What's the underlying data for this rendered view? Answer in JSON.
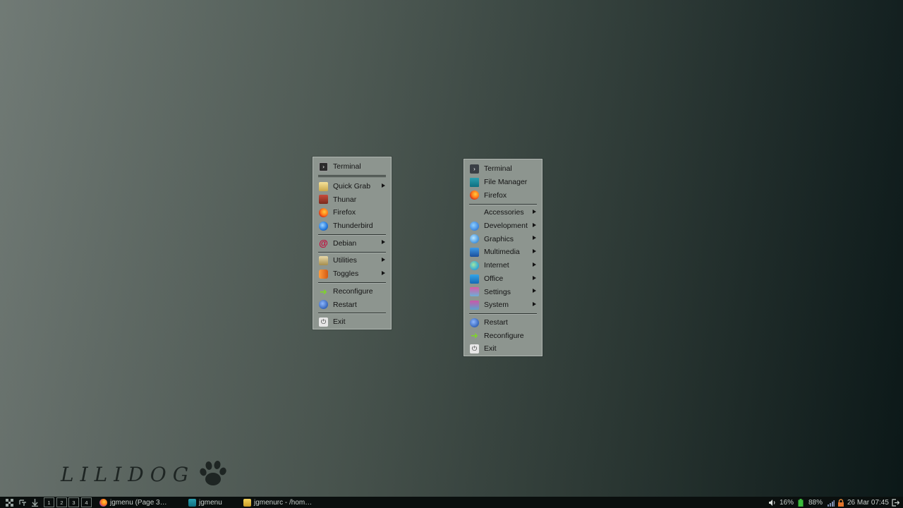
{
  "menu_left": {
    "items": [
      {
        "label": "Terminal",
        "icon": "terminal-icon",
        "submenu": false
      },
      {
        "sep": "double"
      },
      {
        "label": "Quick Grab",
        "icon": "quick-grab-icon",
        "submenu": true
      },
      {
        "label": "Thunar",
        "icon": "thunar-icon",
        "submenu": false
      },
      {
        "label": "Firefox",
        "icon": "firefox-icon",
        "submenu": false
      },
      {
        "label": "Thunderbird",
        "icon": "thunderbird-icon",
        "submenu": false
      },
      {
        "sep": "single"
      },
      {
        "label": "Debian",
        "icon": "debian-icon",
        "submenu": true
      },
      {
        "sep": "single"
      },
      {
        "label": "Utilities",
        "icon": "utilities-icon",
        "submenu": true
      },
      {
        "label": "Toggles",
        "icon": "toggles-icon",
        "submenu": true
      },
      {
        "sep": "single"
      },
      {
        "label": "Reconfigure",
        "icon": "reconfigure-icon",
        "submenu": false
      },
      {
        "label": "Restart",
        "icon": "restart-icon",
        "submenu": false
      },
      {
        "sep": "single"
      },
      {
        "label": "Exit",
        "icon": "exit-icon",
        "submenu": false
      }
    ]
  },
  "menu_right": {
    "items": [
      {
        "label": "Terminal",
        "icon": "terminal-icon",
        "submenu": false
      },
      {
        "label": "File Manager",
        "icon": "file-manager-icon",
        "submenu": false
      },
      {
        "label": "Firefox",
        "icon": "firefox-icon",
        "submenu": false
      },
      {
        "sep": "single"
      },
      {
        "label": "Accessories",
        "icon": "",
        "submenu": true
      },
      {
        "label": "Development",
        "icon": "development-icon",
        "submenu": true
      },
      {
        "label": "Graphics",
        "icon": "graphics-icon",
        "submenu": true
      },
      {
        "label": "Multimedia",
        "icon": "multimedia-icon",
        "submenu": true
      },
      {
        "label": "Internet",
        "icon": "internet-icon",
        "submenu": true
      },
      {
        "label": "Office",
        "icon": "office-icon",
        "submenu": true
      },
      {
        "label": "Settings",
        "icon": "settings-icon",
        "submenu": true
      },
      {
        "label": "System",
        "icon": "system-icon",
        "submenu": true
      },
      {
        "sep": "single"
      },
      {
        "label": "Restart",
        "icon": "restart-icon",
        "submenu": false
      },
      {
        "label": "Reconfigure",
        "icon": "reconfigure-icon",
        "submenu": false
      },
      {
        "label": "Exit",
        "icon": "exit-icon",
        "submenu": false
      }
    ]
  },
  "brand": {
    "text": "LILIDOG"
  },
  "taskbar": {
    "workspaces": [
      "1",
      "2",
      "3",
      "4"
    ],
    "tasks": [
      {
        "label": "jgmenu (Page 3…",
        "icon": "firefox-icon"
      },
      {
        "label": "jgmenu",
        "icon": "folder-icon"
      },
      {
        "label": "jgmenurc - /hom…",
        "icon": "text-editor-icon"
      }
    ],
    "volume": "16%",
    "battery": "88%",
    "clock": "26 Mar 07:45"
  },
  "colors": {
    "menu_bg": "#8d958f",
    "taskbar_bg": "#0a0f0e",
    "desktop_left": "#6c7671",
    "desktop_right": "#0c1919"
  }
}
